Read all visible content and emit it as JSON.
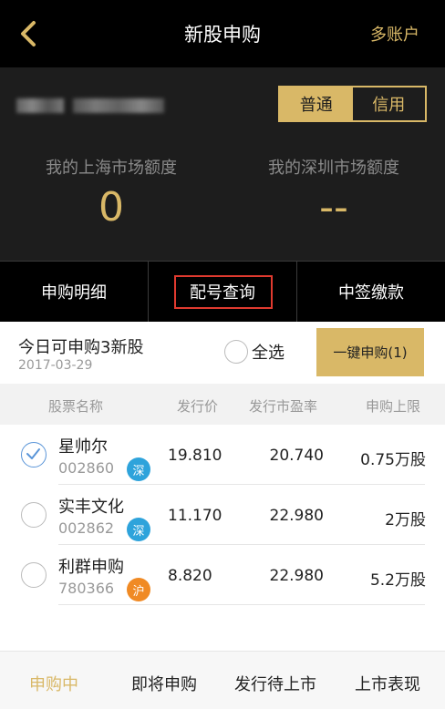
{
  "header": {
    "title": "新股申购",
    "right_link": "多账户"
  },
  "account": {
    "segment": {
      "options": [
        "普通",
        "信用"
      ],
      "selected": "普通"
    },
    "shanghai": {
      "label": "我的上海市场额度",
      "value": "0"
    },
    "shenzhen": {
      "label": "我的深圳市场额度",
      "value": "--"
    }
  },
  "tabs": [
    "申购明细",
    "配号查询",
    "中签缴款"
  ],
  "today": {
    "title": "今日可申购3新股",
    "date": "2017-03-29",
    "select_all": "全选",
    "one_click": "一键申购(1)"
  },
  "table": {
    "headers": [
      "股票名称",
      "发行价",
      "发行市盈率",
      "申购上限"
    ],
    "rows": [
      {
        "name": "星帅尔",
        "code": "002860",
        "market": "深",
        "price": "19.810",
        "pe": "20.740",
        "limit": "0.75万股",
        "checked": true
      },
      {
        "name": "实丰文化",
        "code": "002862",
        "market": "深",
        "price": "11.170",
        "pe": "22.980",
        "limit": "2万股",
        "checked": false
      },
      {
        "name": "利群申购",
        "code": "780366",
        "market": "沪",
        "price": "8.820",
        "pe": "22.980",
        "limit": "5.2万股",
        "checked": false
      }
    ]
  },
  "bottom_tabs": [
    "申购中",
    "即将申购",
    "发行待上市",
    "上市表现"
  ],
  "colors": {
    "gold": "#d9b867",
    "sz_badge": "#2ea3db",
    "sh_badge": "#f08a24",
    "highlight": "#e03a2f",
    "check": "#5a95d8"
  },
  "icons": {
    "back": "chevron-left-icon",
    "check": "check-icon"
  }
}
